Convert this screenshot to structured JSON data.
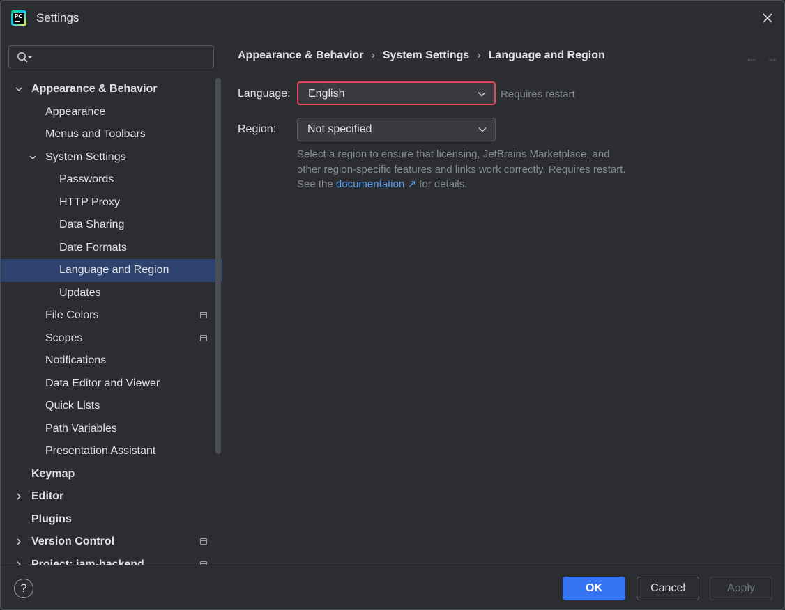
{
  "window": {
    "title": "Settings",
    "app_icon_text": "PC"
  },
  "search": {
    "value": "",
    "placeholder": ""
  },
  "sidebar": {
    "items": [
      {
        "label": "Appearance & Behavior",
        "level": 0,
        "bold": true,
        "chevron": "down",
        "name": "sidebar-item-appearance-behavior"
      },
      {
        "label": "Appearance",
        "level": 1,
        "name": "sidebar-item-appearance"
      },
      {
        "label": "Menus and Toolbars",
        "level": 1,
        "name": "sidebar-item-menus-toolbars"
      },
      {
        "label": "System Settings",
        "level": 1,
        "chevron": "down",
        "name": "sidebar-item-system-settings"
      },
      {
        "label": "Passwords",
        "level": 2,
        "name": "sidebar-item-passwords"
      },
      {
        "label": "HTTP Proxy",
        "level": 2,
        "name": "sidebar-item-http-proxy"
      },
      {
        "label": "Data Sharing",
        "level": 2,
        "name": "sidebar-item-data-sharing"
      },
      {
        "label": "Date Formats",
        "level": 2,
        "name": "sidebar-item-date-formats"
      },
      {
        "label": "Language and Region",
        "level": 2,
        "selected": true,
        "name": "sidebar-item-language-region"
      },
      {
        "label": "Updates",
        "level": 2,
        "name": "sidebar-item-updates"
      },
      {
        "label": "File Colors",
        "level": 1,
        "config_icon": true,
        "name": "sidebar-item-file-colors"
      },
      {
        "label": "Scopes",
        "level": 1,
        "config_icon": true,
        "name": "sidebar-item-scopes"
      },
      {
        "label": "Notifications",
        "level": 1,
        "name": "sidebar-item-notifications"
      },
      {
        "label": "Data Editor and Viewer",
        "level": 1,
        "name": "sidebar-item-data-editor"
      },
      {
        "label": "Quick Lists",
        "level": 1,
        "name": "sidebar-item-quick-lists"
      },
      {
        "label": "Path Variables",
        "level": 1,
        "name": "sidebar-item-path-variables"
      },
      {
        "label": "Presentation Assistant",
        "level": 1,
        "name": "sidebar-item-presentation-assistant"
      },
      {
        "label": "Keymap",
        "level": 0,
        "bold": true,
        "name": "sidebar-item-keymap"
      },
      {
        "label": "Editor",
        "level": 0,
        "bold": true,
        "chevron": "right",
        "name": "sidebar-item-editor"
      },
      {
        "label": "Plugins",
        "level": 0,
        "bold": true,
        "name": "sidebar-item-plugins"
      },
      {
        "label": "Version Control",
        "level": 0,
        "bold": true,
        "chevron": "right",
        "config_icon": true,
        "name": "sidebar-item-version-control"
      },
      {
        "label": "Project: jam-backend",
        "level": 0,
        "bold": true,
        "chevron": "right",
        "config_icon": true,
        "name": "sidebar-item-project"
      }
    ]
  },
  "breadcrumb": [
    "Appearance & Behavior",
    "System Settings",
    "Language and Region"
  ],
  "nav": {
    "back_glyph": "←",
    "forward_glyph": "→"
  },
  "form": {
    "language_label": "Language:",
    "language_value": "English",
    "language_hint": "Requires restart",
    "region_label": "Region:",
    "region_value": "Not specified",
    "region_desc_before": "Select a region to ensure that licensing, JetBrains Marketplace, and other region-specific features and links work correctly. Requires restart. See the",
    "region_desc_link": "documentation",
    "region_desc_link_glyph": "↗",
    "region_desc_after": "for details."
  },
  "footer": {
    "help_label": "?",
    "ok_label": "OK",
    "cancel_label": "Cancel",
    "apply_label": "Apply"
  },
  "colors": {
    "background": "#2b2d30",
    "selection": "#2e436e",
    "accent": "#3574f0",
    "link": "#589df6",
    "focus_ring": "#e1465e"
  }
}
